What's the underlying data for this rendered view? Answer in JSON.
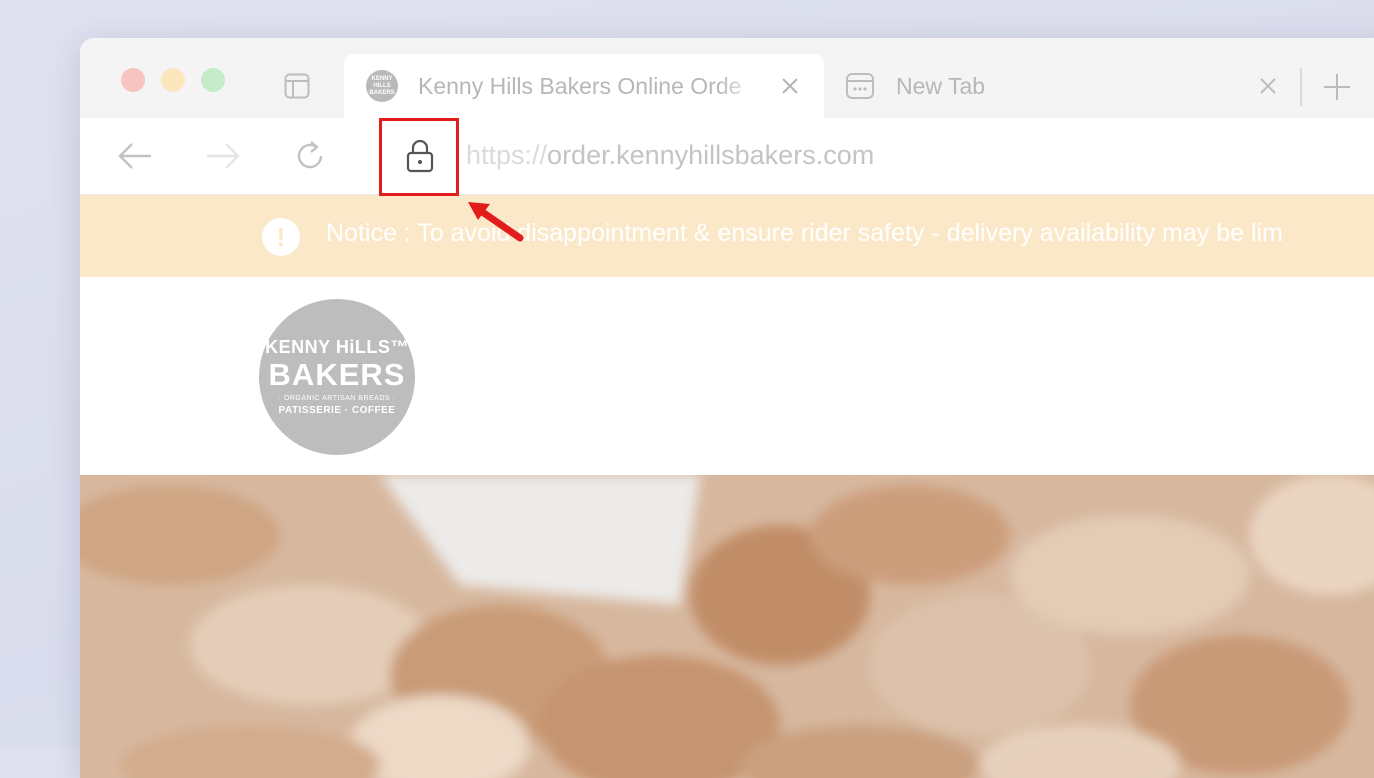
{
  "browser": {
    "tabs": [
      {
        "title": "Kenny Hills Bakers Online Orde",
        "favicon": "kenny-hills-bakers-logo",
        "active": true
      },
      {
        "title": "New Tab",
        "favicon": "new-tab-grid-icon",
        "active": false
      }
    ],
    "url": {
      "scheme": "https://",
      "host": "order.kennyhillsbakers.com"
    }
  },
  "notice": {
    "text": "Notice : To avoid disappointment & ensure rider safety - delivery availability may be lim",
    "icon": "exclamation-icon"
  },
  "logo": {
    "line1": "KENNY HiLLS™",
    "line2": "BAKERS",
    "line3": "· ORGANIC ARTISAN BREADS ·",
    "line4": "PATISSERIE · COFFEE"
  },
  "hero": {
    "image": "baked-pastry-photo"
  },
  "annotation": {
    "highlight_color": "#e21b1b",
    "target": "lock-icon"
  },
  "colors": {
    "notice_bg": "#fbe8c9",
    "highlight": "#e21b1b",
    "logo_bg": "#bdbdbd"
  }
}
